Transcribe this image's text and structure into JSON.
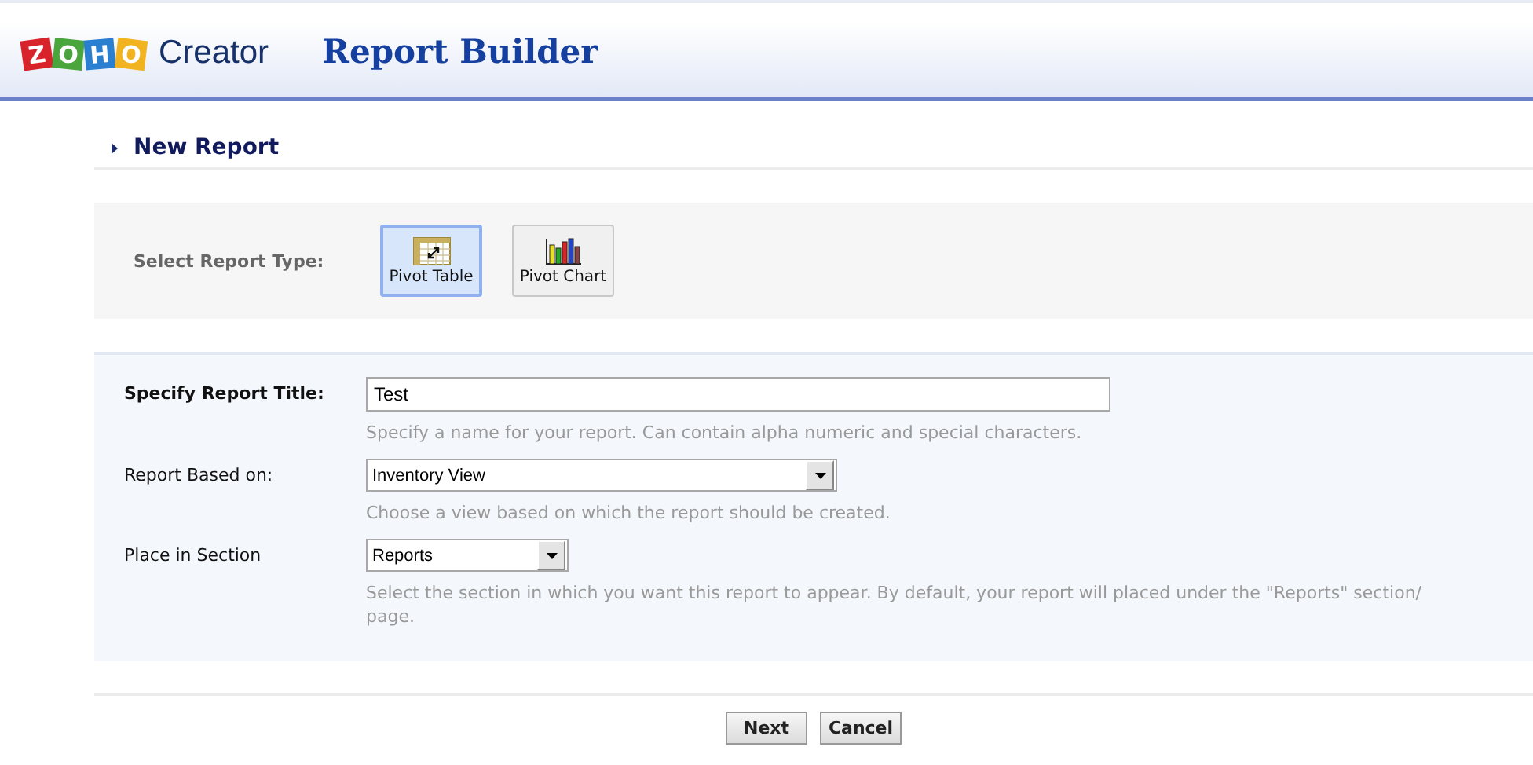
{
  "header": {
    "logo_letters": [
      {
        "char": "Z",
        "color": "#d9232a"
      },
      {
        "char": "O",
        "color": "#4aa53c"
      },
      {
        "char": "H",
        "color": "#2a7fd0"
      },
      {
        "char": "O",
        "color": "#f2b320"
      }
    ],
    "logo_text": "Creator",
    "title": "Report Builder"
  },
  "section_title": "New Report",
  "report_type": {
    "label": "Select Report Type:",
    "options": [
      {
        "kind": "table",
        "label": "Pivot Table",
        "selected": true
      },
      {
        "kind": "chart",
        "label": "Pivot Chart",
        "selected": false
      }
    ]
  },
  "fields": [
    {
      "kind": "text",
      "label": "Specify Report Title:",
      "value": "Test",
      "hint": "Specify a name for your report. Can contain alpha numeric and special characters."
    },
    {
      "kind": "select",
      "label": "Report Based on:",
      "value": "Inventory View",
      "hint": "Choose a view based on which the report should be created."
    },
    {
      "kind": "select-short",
      "label": "Place in Section",
      "value": "Reports",
      "hint": "Select the section in which you want this report to appear. By default, your report will placed under the \"Reports\" section/ page."
    }
  ],
  "buttons": [
    "Next",
    "Cancel"
  ]
}
